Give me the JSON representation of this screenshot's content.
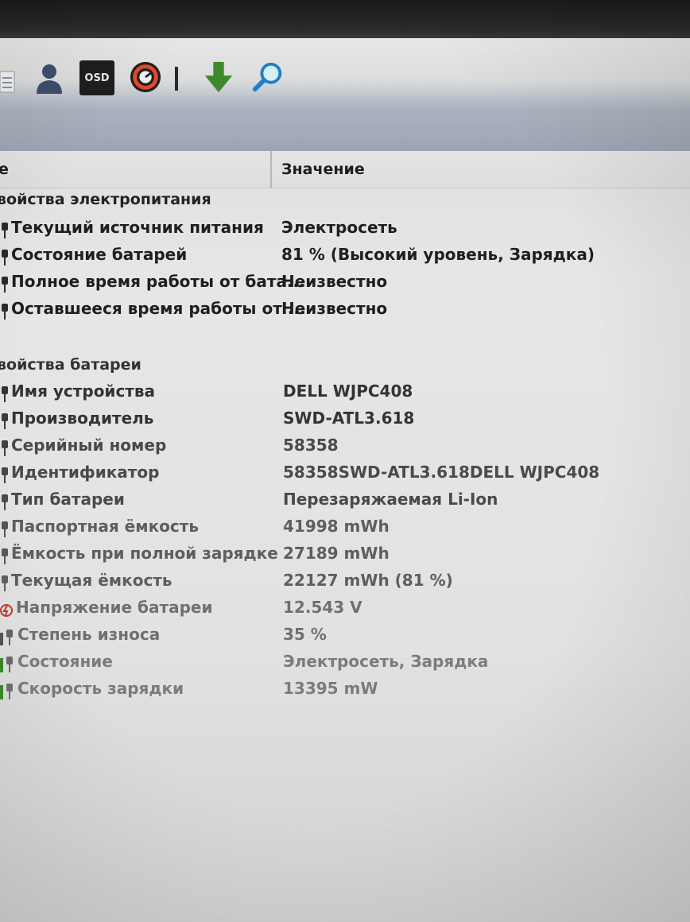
{
  "toolbar": {
    "osd_label": "OSD",
    "icons": [
      "report-icon",
      "user-icon",
      "osd-icon",
      "gauge-icon",
      "download-icon",
      "search-icon"
    ]
  },
  "table": {
    "header_left": "е",
    "header_value": "Значение"
  },
  "sections": [
    {
      "title": "войства электропитания",
      "rows": [
        {
          "label": "Текущий источник питания",
          "value": "Электросеть"
        },
        {
          "label": "Состояние батарей",
          "value": "81 % (Высокий уровень, Зарядка)"
        },
        {
          "label": "Полное время работы от бата...",
          "value": "Неизвестно"
        },
        {
          "label": "Оставшееся время работы от ...",
          "value": "Неизвестно"
        }
      ]
    },
    {
      "title": "войства батареи",
      "rows": [
        {
          "label": "Имя устройства",
          "value": "DELL WJPC408"
        },
        {
          "label": "Производитель",
          "value": "SWD-ATL3.618"
        },
        {
          "label": "Серийный номер",
          "value": "58358"
        },
        {
          "label": "Идентификатор",
          "value": "58358SWD-ATL3.618DELL WJPC408"
        },
        {
          "label": "Тип батареи",
          "value": "Перезаряжаемая Li-Ion"
        },
        {
          "label": "Паспортная ёмкость",
          "value": "41998 mWh"
        },
        {
          "label": "Ёмкость при полной зарядке",
          "value": "27189 mWh"
        },
        {
          "label": "Текущая ёмкость",
          "value": "22127 mWh  (81 %)"
        },
        {
          "label": "Напряжение батареи",
          "value": "12.543 V"
        },
        {
          "label": "Степень износа",
          "value": "35 %"
        },
        {
          "label": "Состояние",
          "value": "Электросеть, Зарядка"
        },
        {
          "label": "Скорость зарядки",
          "value": "13395 mW"
        }
      ]
    }
  ]
}
